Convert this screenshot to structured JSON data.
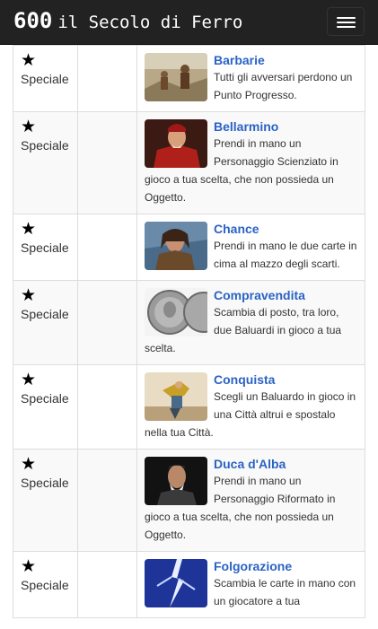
{
  "header": {
    "brand_number": "600",
    "brand_title": "il Secolo di Ferro",
    "menu_icon": "hamburger-menu-icon"
  },
  "cards": [
    {
      "type": "Speciale",
      "name": "Barbarie",
      "description": "Tutti gli avversari perdono un Punto Progresso."
    },
    {
      "type": "Speciale",
      "name": "Bellarmino",
      "description": "Prendi in mano un Personaggio Scienziato in gioco a tua scelta, che non possieda un Oggetto."
    },
    {
      "type": "Speciale",
      "name": "Chance",
      "description": "Prendi in mano le due carte in cima al mazzo degli scarti."
    },
    {
      "type": "Speciale",
      "name": "Compravendita",
      "description": "Scambia di posto, tra loro, due Baluardi in gioco a tua scelta."
    },
    {
      "type": "Speciale",
      "name": "Conquista",
      "description": "Scegli un Baluardo in gioco in una Città altrui e spostalo nella tua Città."
    },
    {
      "type": "Speciale",
      "name": "Duca d'Alba",
      "description": "Prendi in mano un Personaggio Riformato in gioco a tua scelta, che non possieda un Oggetto."
    },
    {
      "type": "Speciale",
      "name": "Folgorazione",
      "description": "Scambia le carte in mano con un giocatore a tua"
    }
  ]
}
